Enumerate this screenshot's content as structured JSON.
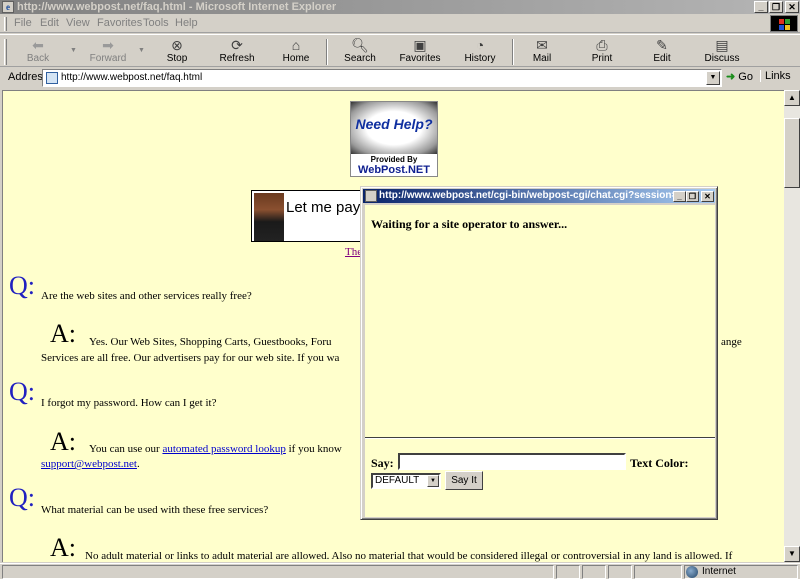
{
  "window": {
    "title": "http://www.webpost.net/faq.html - Microsoft Internet Explorer",
    "controls": {
      "minimize": "_",
      "restore": "❐",
      "close": "✕"
    }
  },
  "menubar": {
    "items": [
      "File",
      "Edit",
      "View",
      "Favorites",
      "Tools",
      "Help"
    ]
  },
  "toolbar": {
    "back": "Back",
    "forward": "Forward",
    "stop": "Stop",
    "refresh": "Refresh",
    "home": "Home",
    "search": "Search",
    "favorites": "Favorites",
    "history": "History",
    "mail": "Mail",
    "print": "Print",
    "edit": "Edit",
    "discuss": "Discuss"
  },
  "addressbar": {
    "label": "Address",
    "url": "http://www.webpost.net/faq.html",
    "go": "Go",
    "links": "Links"
  },
  "page": {
    "logo": {
      "headline": "Need Help?",
      "provided_by": "Provided By",
      "brand": "WebPost.NET"
    },
    "banner": {
      "text": "Let me pay",
      "link_fragment": "The"
    },
    "faq": [
      {
        "q_mark": "Q:",
        "question": "Are the web sites and other services really free?",
        "a_mark": "A:",
        "answer_line1": "Yes. Our Web Sites, Shopping Carts, Guestbooks, Foru",
        "answer_line1_tail": "ange",
        "answer_line2": "Services are all free. Our advertisers pay for our web site. If you wa"
      },
      {
        "q_mark": "Q:",
        "question": "I forgot my password. How can I get it?",
        "a_mark": "A:",
        "answer_prefix": "You can use our ",
        "answer_link": "automated password lookup",
        "answer_suffix": " if you know",
        "answer_line2_link": "support@webpost.net",
        "answer_line2_end": "."
      },
      {
        "q_mark": "Q:",
        "question": "What material can be used with these free services?",
        "a_mark": "A:",
        "answer_line1": "No adult material or links to adult material are allowed. Also no material that would be considered illegal or controversial in any land is allowed. If"
      }
    ]
  },
  "chat_popup": {
    "title": "http://www.webpost.net/cgi-bin/webpost-cgi/chat.cgi?session=...",
    "status": "Waiting for a site operator to answer...",
    "say_label": "Say:",
    "say_value": "",
    "text_color_label": "Text Color:",
    "color_selected": "DEFAULT",
    "say_button": "Say It"
  },
  "statusbar": {
    "zone": "Internet"
  }
}
